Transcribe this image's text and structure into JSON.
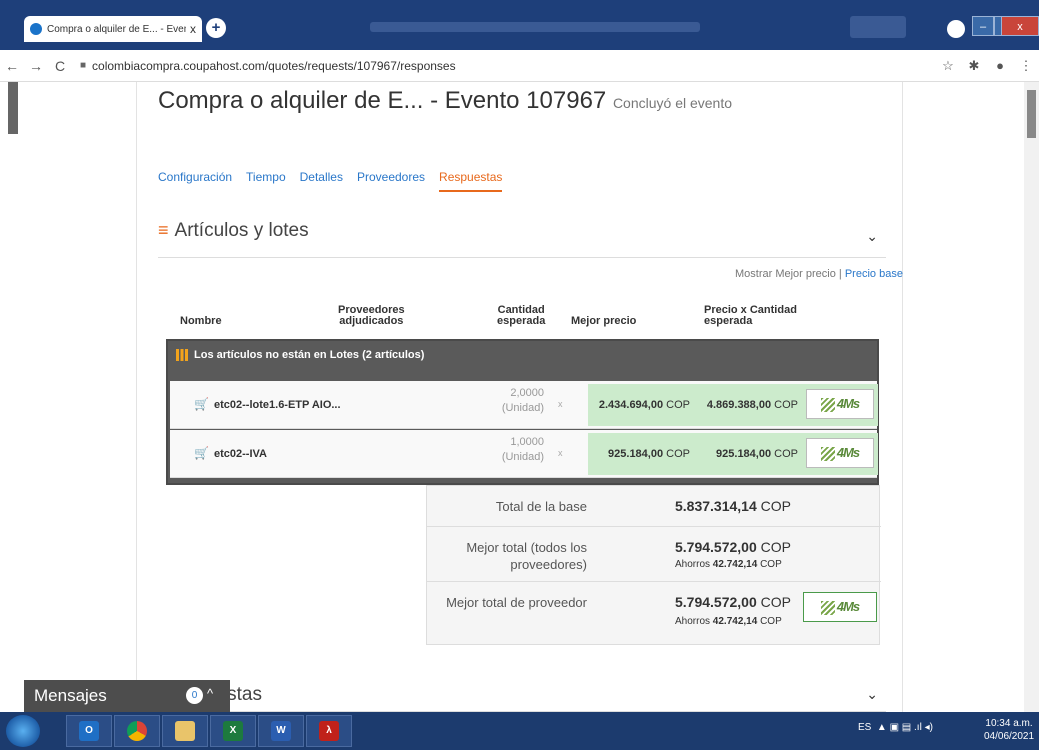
{
  "browser": {
    "tab_title": "Compra o alquiler de E... - Evento",
    "tab_close": "x",
    "new_tab": "+",
    "url": "colombiacompra.coupahost.com/quotes/requests/107967/responses",
    "back": "←",
    "forward": "→",
    "reload": "C",
    "star": "☆",
    "extensions": "✱",
    "menu": "⋮",
    "min": "–",
    "max": "▫",
    "close": "x"
  },
  "page": {
    "title": "Compra o alquiler de E... - Evento 107967",
    "status": "Concluyó el evento"
  },
  "tabs": [
    {
      "label": "Configuración"
    },
    {
      "label": "Tiempo"
    },
    {
      "label": "Detalles"
    },
    {
      "label": "Proveedores"
    },
    {
      "label": "Respuestas"
    }
  ],
  "section": {
    "title": "Artículos y lotes",
    "toggle_prefix": "Mostrar Mejor precio",
    "toggle_sep": " | ",
    "toggle_link": "Precio base"
  },
  "columns": {
    "name": "Nombre",
    "suppliers": "Proveedores\nadjudicados",
    "qty": "Cantidad\nesperada",
    "best": "Mejor precio",
    "price_qty": "Precio x Cantidad\nesperada"
  },
  "lot": {
    "title": "Los artículos no están en Lotes (2 artículos)"
  },
  "items": [
    {
      "name": "etc02--lote1.6-ETP AIO...",
      "qty": "2,0000",
      "unit": "(Unidad)",
      "x": "x",
      "best": "2.434.694,00",
      "best_cur": "COP",
      "ext": "4.869.388,00",
      "ext_cur": "COP",
      "supplier": "4Ms"
    },
    {
      "name": "etc02--IVA",
      "qty": "1,0000",
      "unit": "(Unidad)",
      "x": "x",
      "best": "925.184,00",
      "best_cur": "COP",
      "ext": "925.184,00",
      "ext_cur": "COP",
      "supplier": "4Ms"
    }
  ],
  "totals": {
    "base_label": "Total de la base",
    "base_value": "5.837.314,14",
    "best_label": "Mejor total (todos los proveedores)",
    "best_value": "5.794.572,00",
    "best_savings_prefix": "Ahorros",
    "best_savings": "42.742,14",
    "supplier_label": "Mejor total de proveedor",
    "supplier_value": "5.794.572,00",
    "supplier_savings_prefix": "Ahorros",
    "supplier_savings": "42.742,14",
    "currency": "COP",
    "supplier_logo": "4Ms"
  },
  "bottom_section": {
    "title": "uestas"
  },
  "messages": {
    "label": "Mensajes",
    "count": "0",
    "up": "^"
  },
  "taskbar": {
    "outlook": "O",
    "excel": "X",
    "word": "W",
    "pdf": "λ",
    "lang": "ES",
    "time": "10:34 a.m.",
    "date": "04/06/2021"
  },
  "colors": {
    "accent_orange": "#e8691c",
    "link_blue": "#2a77c9",
    "best_price_green": "#ccebcc",
    "lot_header": "#5a5a5a"
  }
}
